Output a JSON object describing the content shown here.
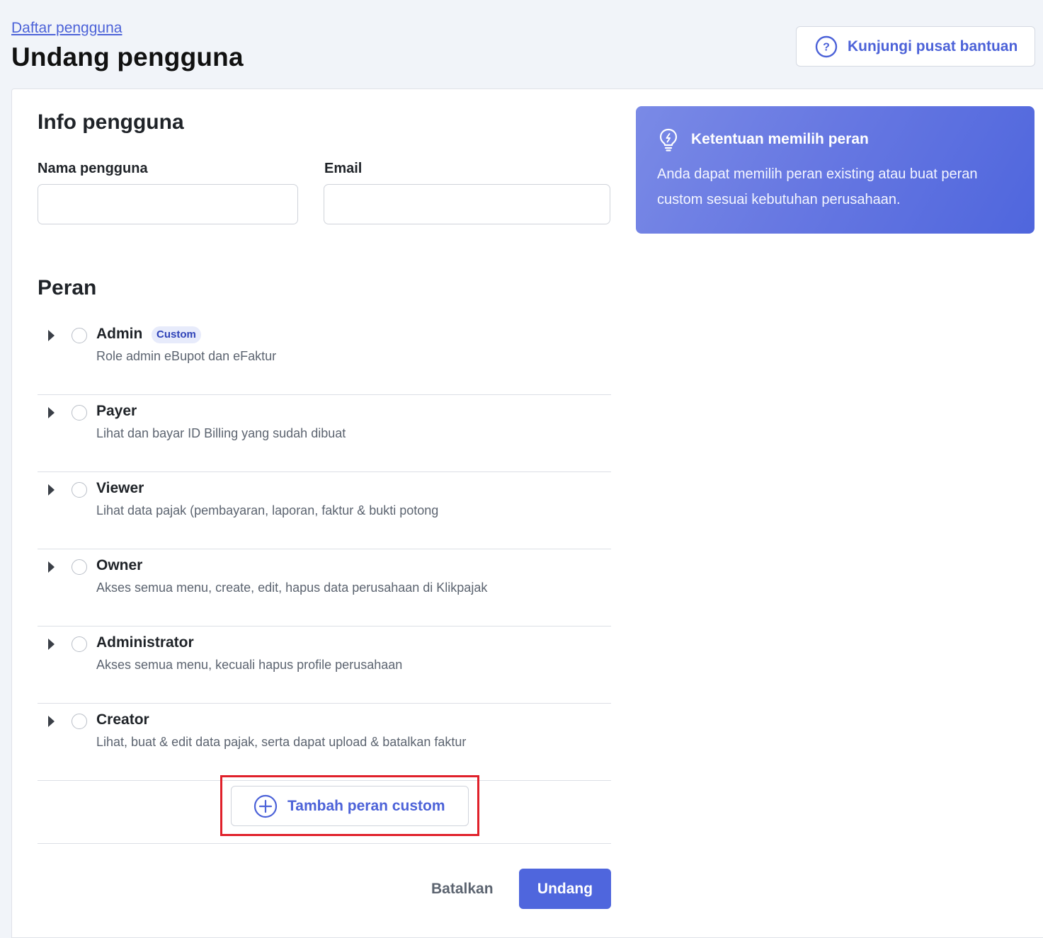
{
  "header": {
    "breadcrumb": "Daftar pengguna",
    "title": "Undang pengguna",
    "help_button": "Kunjungi pusat bantuan"
  },
  "user_info": {
    "title": "Info pengguna",
    "name_label": "Nama pengguna",
    "name_value": "",
    "email_label": "Email",
    "email_value": ""
  },
  "roles": {
    "title": "Peran",
    "items": [
      {
        "name": "Admin",
        "badge": "Custom",
        "description": "Role admin eBupot dan eFaktur"
      },
      {
        "name": "Payer",
        "description": "Lihat dan bayar ID Billing yang sudah dibuat"
      },
      {
        "name": "Viewer",
        "description": "Lihat data pajak (pembayaran, laporan, faktur & bukti potong"
      },
      {
        "name": "Owner",
        "description": "Akses semua menu, create, edit, hapus data perusahaan di Klikpajak"
      },
      {
        "name": "Administrator",
        "description": "Akses semua menu, kecuali hapus profile perusahaan"
      },
      {
        "name": "Creator",
        "description": "Lihat, buat & edit data pajak, serta dapat upload & batalkan faktur"
      }
    ],
    "add_custom_label": "Tambah peran custom"
  },
  "actions": {
    "cancel": "Batalkan",
    "submit": "Undang"
  },
  "info_box": {
    "title": "Ketentuan memilih peran",
    "body": "Anda dapat memilih peran existing atau buat peran custom sesuai kebutuhan perusahaan."
  },
  "colors": {
    "accent": "#4f66dd",
    "link": "#4c62d8",
    "highlight_border": "#e0202a",
    "page_bg": "#f1f4f9"
  },
  "icons": {
    "help": "question-circle-icon",
    "add": "plus-circle-icon",
    "expand": "caret-right-icon",
    "tip": "lightbulb-icon"
  }
}
